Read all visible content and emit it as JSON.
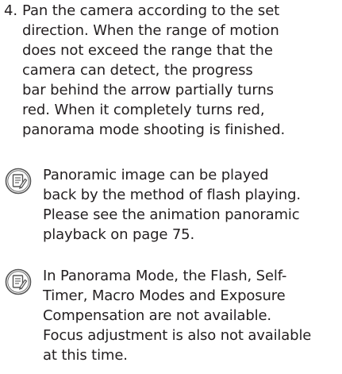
{
  "step": {
    "number": "4.",
    "lines": [
      "Pan the camera according to the set",
      "direction. When the range of motion",
      "does not exceed the range that the",
      "camera can detect, the progress",
      "bar behind the arrow partially turns",
      "red. When it completely turns red,",
      "panorama mode shooting is finished."
    ]
  },
  "notes": [
    {
      "icon": "memo-note-icon",
      "lines": [
        "Panoramic image can be played",
        "back by the method of flash playing.",
        "Please see the animation panoramic",
        "playback on page 75."
      ]
    },
    {
      "icon": "memo-note-icon",
      "lines": [
        "In Panorama Mode, the Flash, Self-",
        "Timer, Macro Modes and Exposure",
        "Compensation are not available.",
        "Focus adjustment is also not available",
        "at this time."
      ]
    }
  ]
}
